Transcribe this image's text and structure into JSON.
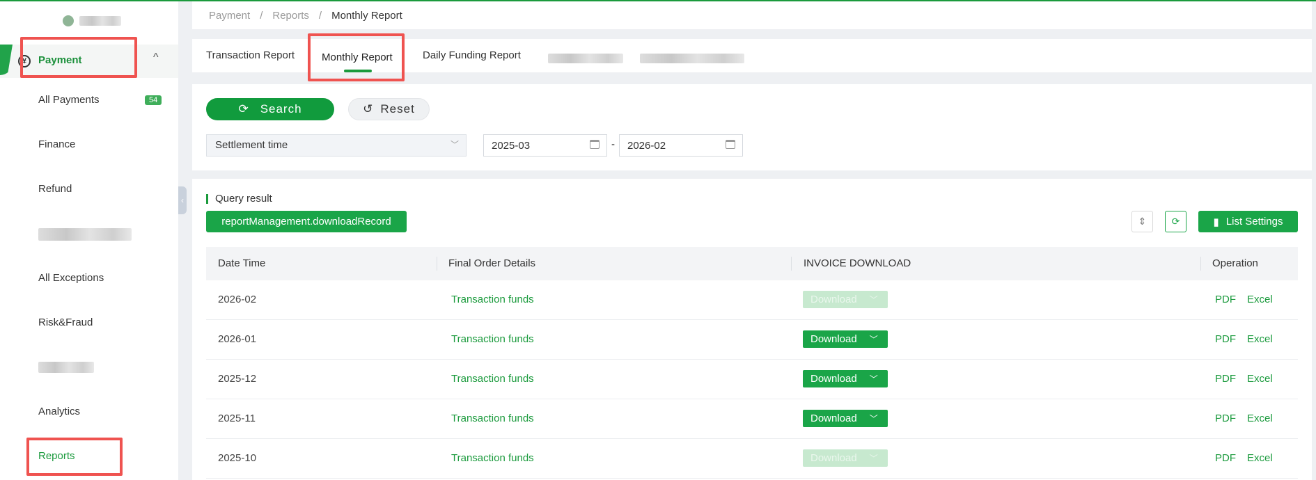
{
  "breadcrumb": [
    "Payment",
    "Reports",
    "Monthly Report"
  ],
  "sidebar": {
    "group_label": "Payment",
    "items": [
      {
        "label": "All Payments",
        "badge": "54"
      },
      {
        "label": "Finance"
      },
      {
        "label": "Refund"
      },
      {
        "label": "All Exceptions"
      },
      {
        "label": "Risk&Fraud"
      },
      {
        "label": "Analytics"
      },
      {
        "label": "Reports"
      }
    ]
  },
  "tabs": [
    "Transaction Report",
    "Monthly Report",
    "Daily Funding Report"
  ],
  "filter": {
    "search_label": "Search",
    "reset_label": "Reset",
    "time_type": "Settlement time",
    "date_from": "2025-03",
    "date_separator": "-",
    "date_to": "2026-02"
  },
  "results": {
    "title": "Query result",
    "download_record_label": "reportManagement.downloadRecord",
    "list_settings_label": "List Settings"
  },
  "table": {
    "headers": [
      "Date Time",
      "Final Order Details",
      "INVOICE DOWNLOAD",
      "Operation"
    ],
    "rows": [
      {
        "date": "2026-02",
        "details": "Transaction funds",
        "download": "Download",
        "enabled": false,
        "pdf": "PDF",
        "excel": "Excel"
      },
      {
        "date": "2026-01",
        "details": "Transaction funds",
        "download": "Download",
        "enabled": true,
        "pdf": "PDF",
        "excel": "Excel"
      },
      {
        "date": "2025-12",
        "details": "Transaction funds",
        "download": "Download",
        "enabled": true,
        "pdf": "PDF",
        "excel": "Excel"
      },
      {
        "date": "2025-11",
        "details": "Transaction funds",
        "download": "Download",
        "enabled": true,
        "pdf": "PDF",
        "excel": "Excel"
      },
      {
        "date": "2025-10",
        "details": "Transaction funds",
        "download": "Download",
        "enabled": false,
        "pdf": "PDF",
        "excel": "Excel"
      }
    ]
  },
  "colors": {
    "accent": "#1a9a3c",
    "highlight": "#ef5350"
  }
}
